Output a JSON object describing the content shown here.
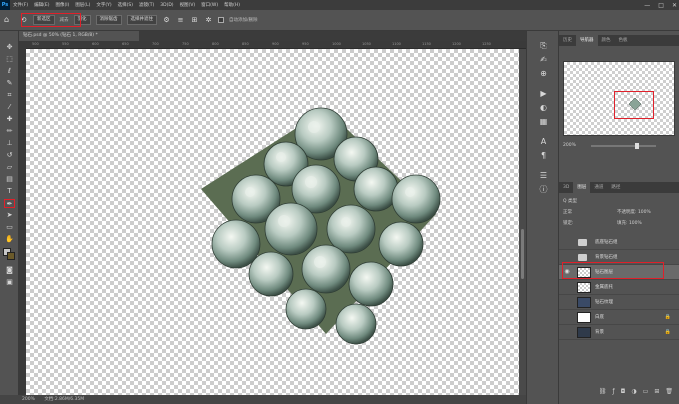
{
  "app": {
    "logo": "Ps"
  },
  "menu": [
    "文件(F)",
    "编辑(E)",
    "图像(I)",
    "图层(L)",
    "文字(Y)",
    "选择(S)",
    "滤镜(T)",
    "3D(D)",
    "视图(V)",
    "窗口(W)",
    "帮助(H)"
  ],
  "window_controls": {
    "minimize": "—",
    "maximize": "□",
    "close": "✕"
  },
  "options": {
    "mode_value": "新选区",
    "mode_label": "减去",
    "feather_value": "羽化",
    "option_a": "消除锯齿",
    "option_b": "选择并遮住",
    "auto_select_label": "自动添加/删除"
  },
  "document": {
    "tab_title": "钻石.psd @ 50% (钻石 1, RGB/8) *"
  },
  "ruler": {
    "labels": [
      "500",
      "550",
      "600",
      "650",
      "700",
      "750",
      "800",
      "850",
      "900",
      "950",
      "1000",
      "1050",
      "1100",
      "1150",
      "1200",
      "1250"
    ]
  },
  "status": {
    "zoom": "200%",
    "doc_size": "文档:2.86M/6.35M"
  },
  "panels": {
    "top_tabs": [
      "历史",
      "导航器",
      "颜色",
      "色板"
    ],
    "top_active": 1,
    "zoom_value": "200%",
    "layer_tabs": [
      "3D",
      "图层",
      "通道",
      "路径"
    ],
    "layer_active": 1,
    "kind_label": "Q 类型",
    "mode_label": "正常",
    "opacity_label": "不透明度: 100%",
    "lock_label": "锁定:",
    "fill_label": "填充: 100%"
  },
  "layers": [
    {
      "name": "底座钻石组",
      "type": "folder",
      "visible": false,
      "locked": false,
      "selected": false
    },
    {
      "name": "背景钻石组",
      "type": "folder",
      "visible": false,
      "locked": false,
      "selected": false
    },
    {
      "name": "钻石图层",
      "type": "pixel",
      "visible": true,
      "locked": false,
      "selected": true
    },
    {
      "name": "金属底托",
      "type": "pixel",
      "visible": false,
      "locked": false,
      "selected": false
    },
    {
      "name": "钻石纹理",
      "type": "pixel",
      "visible": false,
      "locked": false,
      "selected": false
    },
    {
      "name": "白底",
      "type": "white",
      "visible": false,
      "locked": true,
      "selected": false
    },
    {
      "name": "背景",
      "type": "dark",
      "visible": false,
      "locked": true,
      "selected": false
    }
  ],
  "colors": {
    "accent_red": "#e0202a",
    "fg": "#c8c8c8",
    "bg": "#6b5a2a",
    "panel": "#535353"
  },
  "icons": [
    "move-icon",
    "marquee-icon",
    "lasso-icon",
    "quick-select-icon",
    "crop-icon",
    "eyedropper-icon",
    "heal-icon",
    "brush-icon",
    "stamp-icon",
    "history-brush-icon",
    "eraser-icon",
    "gradient-icon",
    "blur-icon",
    "dodge-icon",
    "pen-icon",
    "type-icon",
    "path-select-icon",
    "shape-icon",
    "hand-icon",
    "zoom-icon"
  ]
}
